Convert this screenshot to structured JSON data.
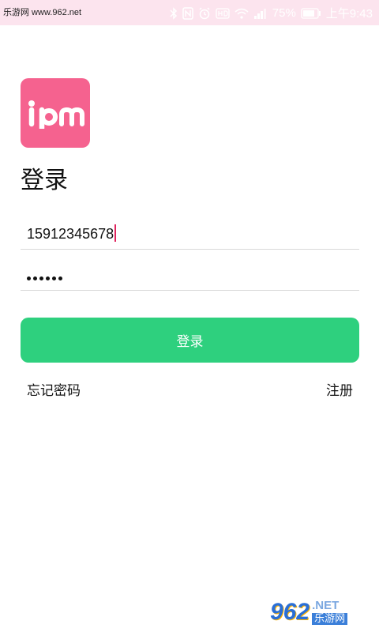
{
  "status_bar": {
    "watermark": "乐游网 www.962.net",
    "battery": "75%",
    "time": "上午9:43"
  },
  "logo": {
    "text": "ipm",
    "color": "#f5628f"
  },
  "title": "登录",
  "form": {
    "phone_value": "15912345678",
    "password_dot_count": 6
  },
  "login_button": {
    "label": "登录",
    "color": "#2ed07e"
  },
  "links": {
    "forgot_password": "忘记密码",
    "register": "注册"
  },
  "watermark_badge": {
    "number": "962",
    "suffix": ".NET",
    "name": "乐游网"
  }
}
